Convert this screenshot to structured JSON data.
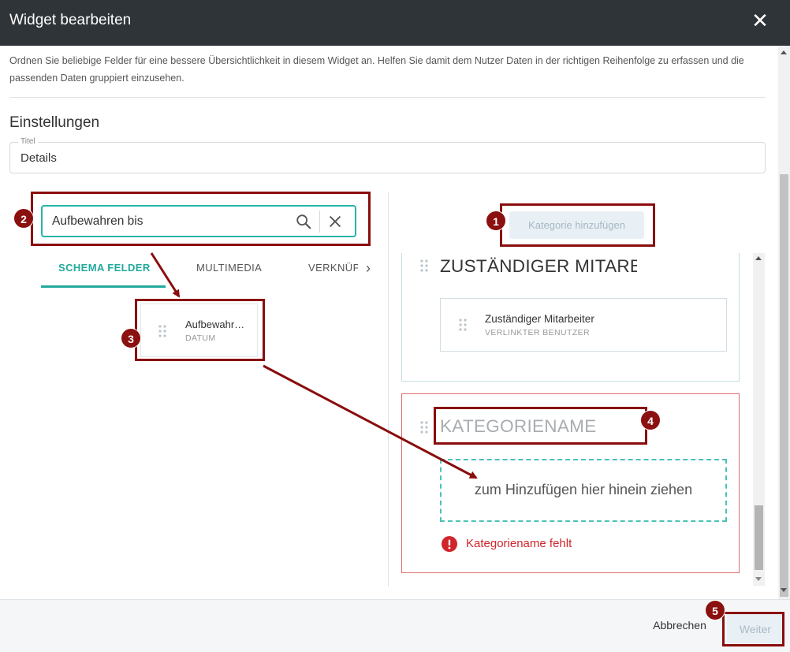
{
  "dialog": {
    "title": "Widget bearbeiten",
    "close_icon": "close-icon"
  },
  "intro": {
    "text": "Ordnen Sie beliebige Felder für eine bessere Übersichtlichkeit in diesem Widget an. Helfen Sie damit dem Nutzer Daten in der richtigen Reihenfolge zu erfassen und die passenden Daten gruppiert einzusehen."
  },
  "settings": {
    "heading": "Einstellungen",
    "title_field": {
      "label": "Titel",
      "value": "Details"
    }
  },
  "left_panel": {
    "search": {
      "value": "Aufbewahren bis",
      "search_icon": "search-icon",
      "clear_icon": "clear-icon"
    },
    "tabs": [
      {
        "label": "SCHEMA FELDER",
        "active": true
      },
      {
        "label": "MULTIMEDIA",
        "active": false
      },
      {
        "label": "VERKNÜPFUNGEN",
        "active": false
      }
    ],
    "fields": [
      {
        "name": "Aufbewahren bis",
        "type": "DATUM"
      }
    ]
  },
  "right_panel": {
    "add_category_label": "Kategorie hinzufügen",
    "categories": [
      {
        "title": "ZUSTÄNDIGER MITARBEITER",
        "fields": [
          {
            "name": "Zuständiger Mitarbeiter",
            "type": "VERLINKTER BENUTZER"
          }
        ]
      },
      {
        "placeholder": "KATEGORIENAME",
        "dropzone_hint": "zum Hinzufügen hier hinein ziehen",
        "error": "Kategoriename fehlt"
      }
    ]
  },
  "footer": {
    "cancel_label": "Abbrechen",
    "next_label": "Weiter"
  },
  "annotations": [
    "1",
    "2",
    "3",
    "4",
    "5"
  ],
  "colors": {
    "titlebar": "#2f3438",
    "accent": "#21a99c",
    "annotation": "#8a0d0d",
    "error": "#d0252c"
  }
}
